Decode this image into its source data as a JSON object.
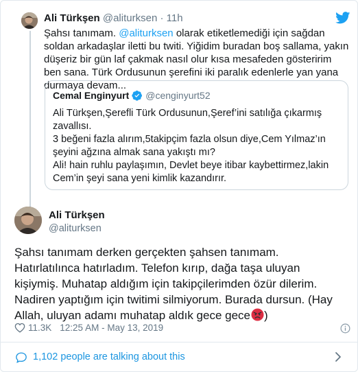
{
  "parent_tweet": {
    "author_name": "Ali Türkşen",
    "handle": "@aliturksen",
    "separator": "·",
    "time": "11h",
    "text_before": "Şahsı tanımam. ",
    "mention": "@aliturksen",
    "text_after": " olarak etiketlemediği için sağdan soldan arkadaşlar iletti bu twiti. Yiğidim buradan boş sallama, yakın düşeriz bir gün laf çakmak nasıl olur kısa mesafeden gösteririm ben sana. Türk Ordusunun şerefini iki paralık edenlerle yan yana durmaya devam...",
    "quote": {
      "author_name": "Cemal Enginyurt",
      "handle": "@cenginyurt52",
      "lines": [
        "Ali Türkşen,Şerefli Türk Ordusunun,Şeref’ini satılığa çıkarmış zavallısı.",
        "3 beğeni fazla alırım,5takipçim fazla olsun diye,Cem Yılmaz’ın şeyini ağzına almak sana yakıştı mı?",
        "Ali! hain ruhlu paylaşımın, Devlet beye itibar kaybettirmez,lakin Cem’in şeyi sana yeni kimlik kazandırır."
      ]
    }
  },
  "main_tweet": {
    "author_name": "Ali Türkşen",
    "handle": "@aliturksen",
    "text": "Şahsı tanımam derken gerçekten şahsen tanımam. Hatırlatılınca hatırladım. Telefon kırıp, dağa taşa uluyan kişiymiş. Muhatap aldığım için takipçilerimden özür dilerim. Nadiren yaptığım için twitimi silmiyorum. Burada dursun. (Hay Allah, uluyan adamı muhatap aldık gece gece",
    "text_end": ")",
    "likes": "11.3K",
    "timestamp": "12:25 AM - May 13, 2019"
  },
  "footer": {
    "talking_text": "1,102 people are talking about this"
  },
  "colors": {
    "link": "#1da1f2",
    "footer_link": "#1b95e0",
    "secondary_text": "#657786",
    "border": "#e1e8ed"
  },
  "icons": [
    "twitter-bird-icon",
    "verified-badge-icon",
    "heart-icon",
    "info-icon",
    "people-icon",
    "chevron-right-icon",
    "angry-face-emoji"
  ]
}
